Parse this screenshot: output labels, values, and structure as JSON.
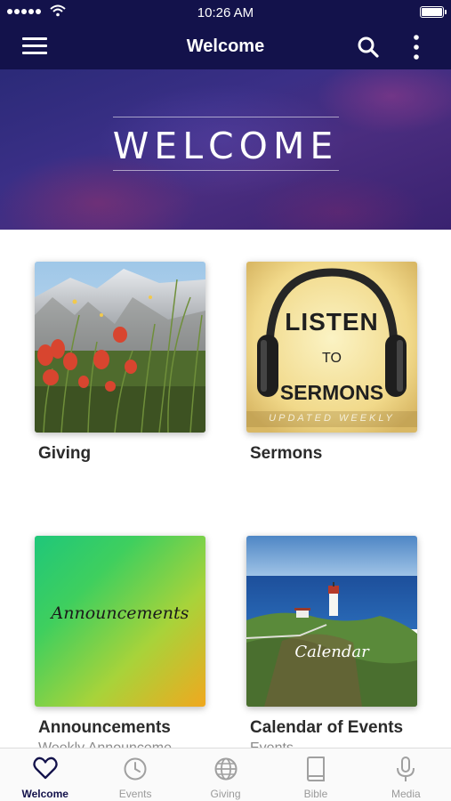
{
  "status_bar": {
    "time": "10:26 AM"
  },
  "nav": {
    "title": "Welcome",
    "menu_icon": "hamburger-menu-icon",
    "search_icon": "search-icon",
    "more_icon": "more-vertical-icon"
  },
  "banner": {
    "title": "WELCOME"
  },
  "tiles": [
    {
      "title": "Giving",
      "subtitle": "",
      "image": "mountain-wildflowers-image"
    },
    {
      "title": "Sermons",
      "subtitle": "",
      "image": "headphones-image",
      "image_text": {
        "line1": "LISTEN",
        "line2": "TO",
        "line3": "SERMONS",
        "line4": "UPDATED WEEKLY"
      }
    },
    {
      "title": "Announcements",
      "subtitle": "Weekly Announceme",
      "image": "gradient-image",
      "image_text": "Announcements"
    },
    {
      "title": "Calendar of Events",
      "subtitle": "Events",
      "image": "lighthouse-image",
      "image_text": "Calendar"
    }
  ],
  "tabs": [
    {
      "label": "Welcome",
      "icon": "heart-icon",
      "active": true
    },
    {
      "label": "Events",
      "icon": "clock-icon",
      "active": false
    },
    {
      "label": "Giving",
      "icon": "globe-icon",
      "active": false
    },
    {
      "label": "Bible",
      "icon": "book-icon",
      "active": false
    },
    {
      "label": "Media",
      "icon": "microphone-icon",
      "active": false
    }
  ],
  "colors": {
    "nav_background": "#13124b",
    "active_tab": "#13124b",
    "inactive_tab": "#9a9a9a"
  }
}
